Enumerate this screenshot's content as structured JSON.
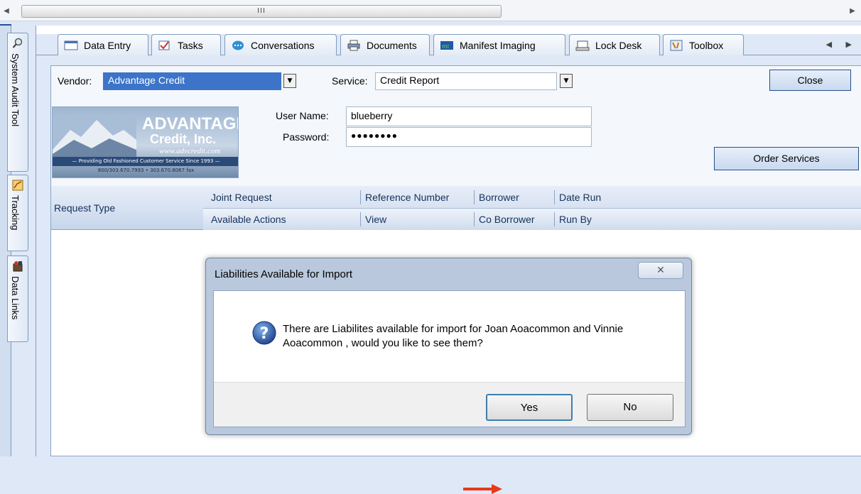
{
  "scrollbar": {
    "left_arrow": "◀",
    "thumb_grip": "III",
    "right_arrow": "▶"
  },
  "vtabs": [
    {
      "label": "System Audit Tool",
      "icon": "magnifier-icon"
    },
    {
      "label": "Tracking",
      "icon": "tracking-icon"
    },
    {
      "label": "Data Links",
      "icon": "data-links-icon"
    }
  ],
  "tabs": [
    {
      "label": "Data Entry",
      "icon": "form-icon"
    },
    {
      "label": "Tasks",
      "icon": "checkbox-icon"
    },
    {
      "label": "Conversations",
      "icon": "chat-bubble-icon"
    },
    {
      "label": "Documents",
      "icon": "printer-icon"
    },
    {
      "label": "Manifest Imaging",
      "icon": "imaging-icon"
    },
    {
      "label": "Lock Desk",
      "icon": "lock-desk-icon"
    },
    {
      "label": "Toolbox",
      "icon": "toolbox-icon"
    }
  ],
  "tab_nav": "◀ ▶",
  "form": {
    "vendor_label": "Vendor:",
    "vendor_value": "Advantage Credit",
    "service_label": "Service:",
    "service_value": "Credit Report",
    "close_label": "Close",
    "username_label": "User Name:",
    "username_value": "blueberry",
    "password_label": "Password:",
    "password_value": "●●●●●●●●",
    "order_label": "Order Services"
  },
  "logo": {
    "line1": "ADVANTAGE",
    "line2": "Credit, Inc.",
    "line3": "www.advcredit.com",
    "line4": "— Providing Old Fashioned Customer Service Since 1993 —",
    "line5": "800/303.670.7993  •  303.670.8067 fax"
  },
  "grid": {
    "request_type": "Request Type",
    "row1": [
      "Joint Request",
      "Reference Number",
      "Borrower",
      "Date Run"
    ],
    "row2": [
      "Available Actions",
      "View",
      "Co Borrower",
      "Run By"
    ]
  },
  "dialog": {
    "title": "Liabilities Available for Import",
    "close_glyph": "✕",
    "message": "There are Liabilites available for import for Joan  Aoacommon and Vinnie  Aoacommon , would you like to see them?",
    "yes_label": "Yes",
    "no_label": "No"
  },
  "colors": {
    "accent": "#1f4fa8",
    "arrow": "#e8391a",
    "panel": "#dfe8f6"
  }
}
